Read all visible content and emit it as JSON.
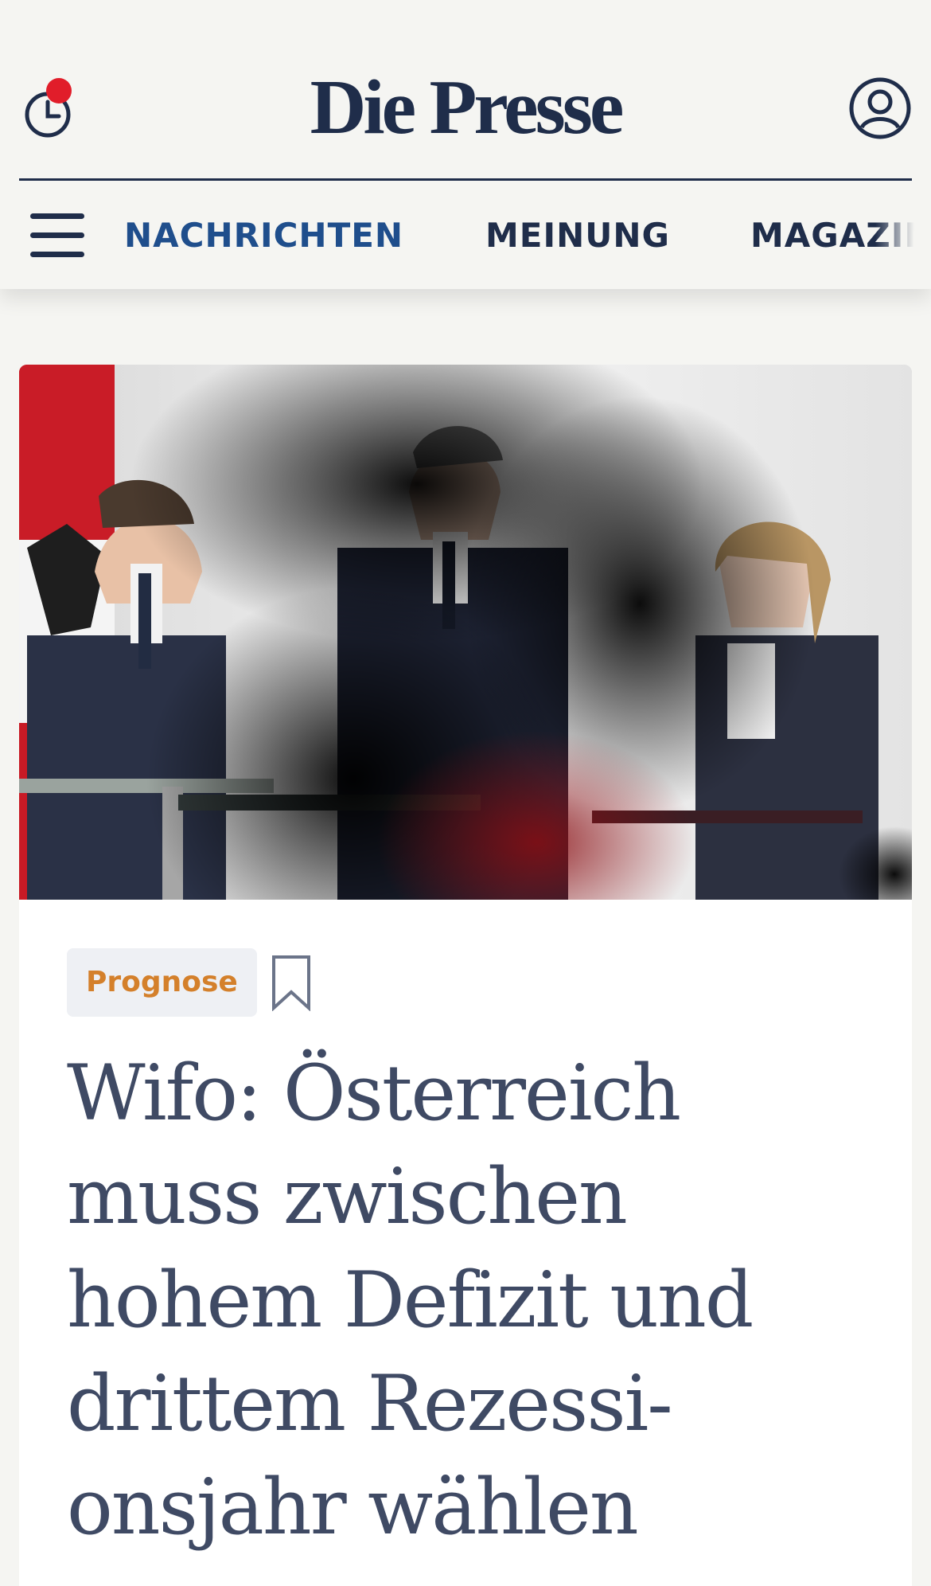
{
  "header": {
    "logo": "Die Presse",
    "history_icon": "clock-icon",
    "account_icon": "user-circle-icon",
    "notification_color": "#e11d2a"
  },
  "nav": {
    "menu_icon": "hamburger-menu-icon",
    "items": [
      {
        "label": "NACHRICHTEN",
        "active": true
      },
      {
        "label": "MEINUNG",
        "active": false
      },
      {
        "label": "MAGAZIN",
        "active": false
      }
    ]
  },
  "article": {
    "image_description": "Drei Personen an Rednerpulten vor österreichischer Flagge",
    "tag": "Prognose",
    "bookmark_icon": "bookmark-icon",
    "headline": "Wifo: Österreich muss zwischen hohem Defizit und drittem Rezessi-onsjahr wählen"
  },
  "colors": {
    "brand_navy": "#1f2d4a",
    "nav_active": "#1f4e8c",
    "tag_text": "#d4802b",
    "headline": "#3f4a64",
    "background": "#f5f5f2"
  }
}
